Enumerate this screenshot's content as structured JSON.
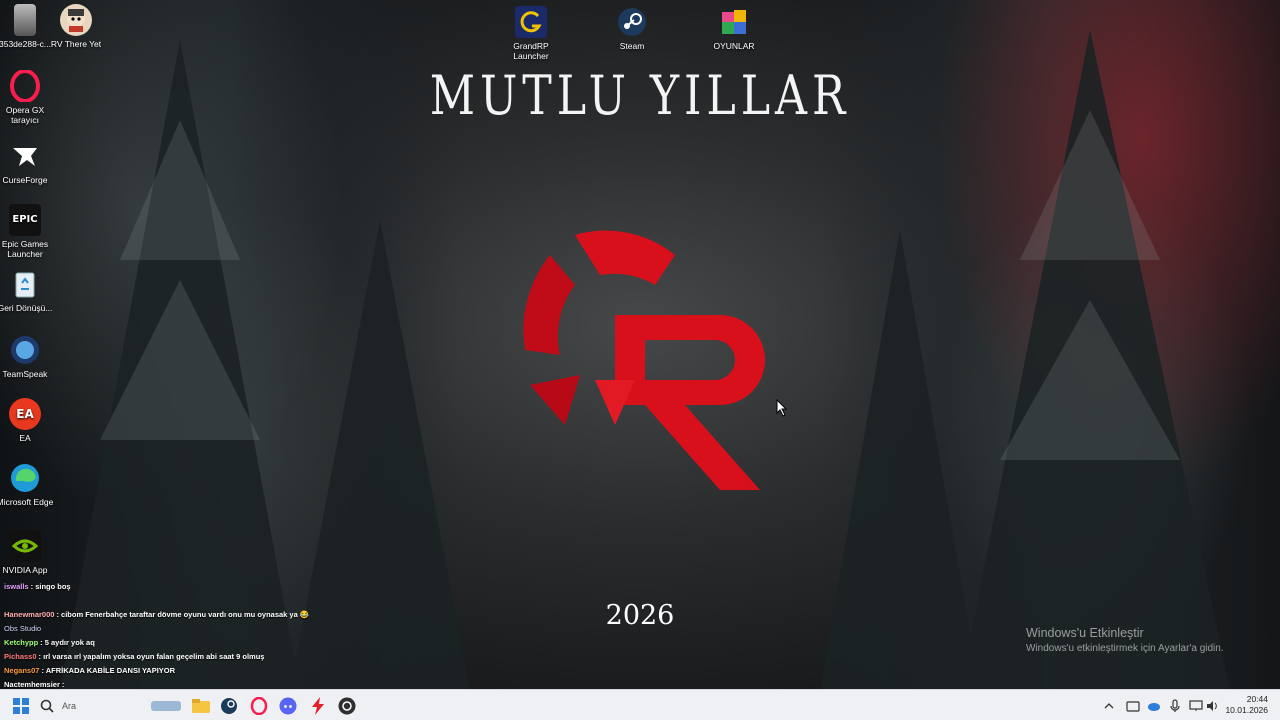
{
  "wallpaper": {
    "title": "MUTLU YILLAR",
    "year": "2026"
  },
  "desktop_icons_left": [
    {
      "label": "353de288-c...",
      "icon": "image-file-icon"
    },
    {
      "label": "RV There Yet",
      "icon": "rv-there-yet-icon"
    },
    {
      "label": "Opera GX tarayıcı",
      "icon": "opera-gx-icon"
    },
    {
      "label": "CurseForge",
      "icon": "curseforge-icon"
    },
    {
      "label": "Epic Games Launcher",
      "icon": "epic-games-icon",
      "glyph": "EPIC"
    },
    {
      "label": "Geri Dönüşü...",
      "icon": "recycle-bin-icon"
    },
    {
      "label": "TeamSpeak",
      "icon": "teamspeak-icon"
    },
    {
      "label": "EA",
      "icon": "ea-icon",
      "glyph": "EA"
    },
    {
      "label": "Microsoft Edge",
      "icon": "edge-icon"
    },
    {
      "label": "NVIDIA App",
      "icon": "nvidia-icon"
    }
  ],
  "desktop_icons_top": [
    {
      "label": "GrandRP Launcher",
      "icon": "grandrp-icon"
    },
    {
      "label": "Steam",
      "icon": "steam-icon"
    },
    {
      "label": "OYUNLAR",
      "icon": "folder-games-icon"
    }
  ],
  "activation": {
    "title": "Windows'u Etkinleştir",
    "subtitle": "Windows'u etkinleştirmek için Ayarlar'a gidin."
  },
  "chat_overlay": [
    {
      "user": "iswalls",
      "user_color": "#e8a0ff",
      "message": ": singo boş"
    },
    {
      "user": "Hanewmar000",
      "user_color": "#ffb0b0",
      "message": ": cibom Fenerbahçe taraftar dövme oyunu vardı onu mu oynasak ya 😂"
    },
    {
      "user": "Obs Studio",
      "user_color": "#cfd8ff",
      "message": ""
    },
    {
      "user": "Ketchypp",
      "user_color": "#9fff7a",
      "message": ": 5 aydır yok aq"
    },
    {
      "user": "Pichass0",
      "user_color": "#ff7a7a",
      "message": ": ırl varsa ırl yapalım yoksa oyun falan geçelim abi saat 9 olmuş"
    },
    {
      "user": "Negans07",
      "user_color": "#ff9a3a",
      "message": ": AFRİKADA KABİLE DANSI YAPIYOR"
    },
    {
      "user": "Nactemhemsier",
      "user_color": "#ffffff",
      "message": ":"
    }
  ],
  "taskbar": {
    "search_placeholder": "Ara",
    "apps": [
      "windows-start-icon",
      "search-icon",
      "widgets-icon",
      "file-explorer-icon",
      "steam-icon",
      "opera-gx-icon",
      "discord-icon",
      "lightning-app-icon",
      "obs-icon"
    ],
    "tray": {
      "time": "20:44",
      "date": "10.01.2026"
    }
  },
  "colors": {
    "logo_red": "#d8101c",
    "taskbar_bg": "#eef0f3"
  }
}
